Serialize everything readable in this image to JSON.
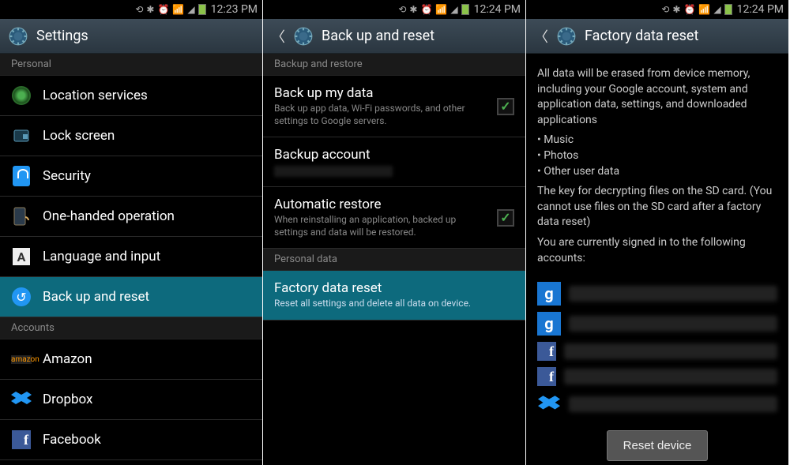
{
  "statusbar": {
    "screen1_time": "12:23 PM",
    "screen2_time": "12:24 PM",
    "screen3_time": "12:24 PM"
  },
  "screen1": {
    "title": "Settings",
    "sections": {
      "personal": "Personal",
      "accounts": "Accounts"
    },
    "items": {
      "location": "Location services",
      "lock": "Lock screen",
      "security": "Security",
      "onehanded": "One-handed operation",
      "language": "Language and input",
      "backup": "Back up and reset",
      "amazon": "Amazon",
      "dropbox": "Dropbox",
      "facebook": "Facebook"
    }
  },
  "screen2": {
    "title": "Back up and reset",
    "sections": {
      "backup_restore": "Backup and restore",
      "personal_data": "Personal data"
    },
    "items": {
      "backup_my_data": {
        "title": "Back up my data",
        "sub": "Back up app data, Wi-Fi passwords, and other settings to Google servers.",
        "checked": true
      },
      "backup_account": {
        "title": "Backup account"
      },
      "automatic_restore": {
        "title": "Automatic restore",
        "sub": "When reinstalling an application, backed up settings and data will be restored.",
        "checked": true
      },
      "factory_reset": {
        "title": "Factory data reset",
        "sub": "Reset all settings and delete all data on device."
      }
    }
  },
  "screen3": {
    "title": "Factory data reset",
    "body": {
      "intro": "All data will be erased from device memory, including your Google account, system and application data, settings, and downloaded applications",
      "bullets": [
        "Music",
        "Photos",
        "Other user data"
      ],
      "sdkey": "The key for decrypting files on the SD card. (You cannot use files on the SD card after a factory data reset)",
      "signed_in": "You are currently signed in to the following accounts:"
    },
    "accounts": [
      {
        "type": "google"
      },
      {
        "type": "google"
      },
      {
        "type": "facebook"
      },
      {
        "type": "facebook"
      },
      {
        "type": "dropbox"
      }
    ],
    "reset_button": "Reset device"
  }
}
